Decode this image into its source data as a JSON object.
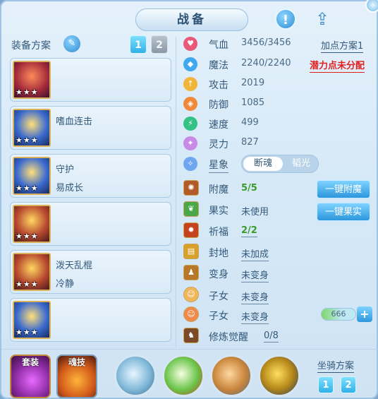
{
  "title": "战备",
  "scheme": {
    "label": "装备方案",
    "tabs": [
      "1",
      "2"
    ]
  },
  "slots": [
    {
      "name": "",
      "sub": "",
      "stars": "★★★"
    },
    {
      "name": "嗜血连击",
      "sub": "",
      "stars": "★★★"
    },
    {
      "name": "守护",
      "sub": "易成长",
      "stars": "★★★"
    },
    {
      "name": "",
      "sub": "",
      "stars": "★★★"
    },
    {
      "name": "泼天乱棍",
      "sub": "冷静",
      "stars": "★★★"
    },
    {
      "name": "",
      "sub": "",
      "stars": "★★★"
    }
  ],
  "stats": [
    {
      "label": "气血",
      "value": "3456/3456"
    },
    {
      "label": "魔法",
      "value": "2240/2240"
    },
    {
      "label": "攻击",
      "value": "2019"
    },
    {
      "label": "防御",
      "value": "1085"
    },
    {
      "label": "速度",
      "value": "499"
    },
    {
      "label": "灵力",
      "value": "827"
    }
  ],
  "add_point_plan": "加点方案1",
  "unassigned_points": "潜力点未分配",
  "star_sign": {
    "label": "星象",
    "options": [
      "断魂",
      "韬光"
    ]
  },
  "features": [
    {
      "label": "附魔",
      "value": "5/5"
    },
    {
      "label": "果实",
      "value": "未使用"
    },
    {
      "label": "祈福",
      "value": "2/2"
    },
    {
      "label": "封地",
      "value": "未加成"
    },
    {
      "label": "变身",
      "value": "未变身"
    },
    {
      "label": "子女",
      "value": "未变身"
    },
    {
      "label": "子女",
      "value": "未变身"
    },
    {
      "label": "修炼觉醒",
      "value": "0/8"
    }
  ],
  "buttons": {
    "enchant": "一键附魔",
    "fruit": "一键果实",
    "plus": "+"
  },
  "child_value": "666",
  "bottom_tabs": {
    "outfit": "套装",
    "soul_skill": "魂技"
  },
  "mount": {
    "label": "坐骑方案",
    "tabs": [
      "1",
      "2"
    ]
  },
  "colors": {
    "accent": "#2c97dd",
    "warning": "#e0201e",
    "good": "#3a9a2a"
  }
}
